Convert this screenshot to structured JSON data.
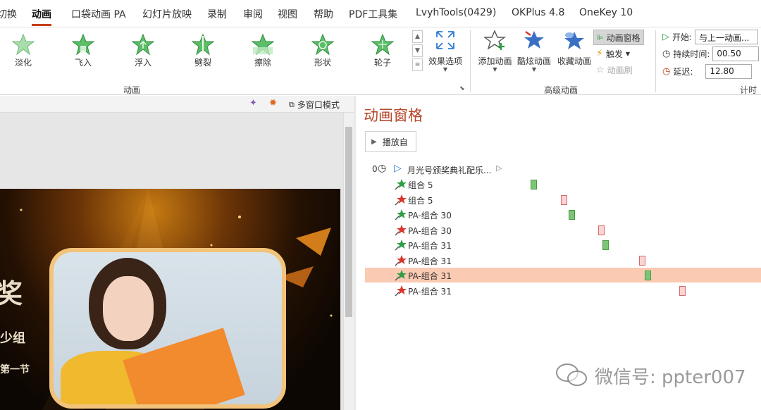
{
  "menu": {
    "tabs": [
      "切换",
      "动画",
      "口袋动画 PA",
      "幻灯片放映",
      "录制",
      "审阅",
      "视图",
      "帮助",
      "PDF工具集",
      "LvyhTools(0429)",
      "OKPlus 4.8",
      "OneKey 10"
    ],
    "active": "动画"
  },
  "ribbon": {
    "animations": [
      "淡化",
      "飞入",
      "浮入",
      "劈裂",
      "擦除",
      "形状",
      "轮子"
    ],
    "effect_options": "效果选项",
    "group_animation": "动画",
    "add_animation": "添加动画",
    "cool_animation": "酷炫动画",
    "collect_animation": "收藏动画",
    "animation_pane": "动画窗格",
    "trigger": "触发",
    "animation_painter": "动画刷",
    "group_advanced": "高级动画",
    "timing": {
      "start_label": "开始:",
      "start_value": "与上一动画...",
      "duration_label": "持续时间:",
      "duration_value": "00.50",
      "delay_label": "延迟:",
      "delay_value": "12.80",
      "group_label": "计时"
    }
  },
  "toolbar_strip": {
    "multiwindow": "多窗口模式"
  },
  "pane": {
    "title": "动画窗格",
    "play_button": "播放自",
    "header_row": {
      "index": "0",
      "label": "月光号颁奖典礼配乐..."
    },
    "items": [
      {
        "label": "组合 5",
        "kind": "entry"
      },
      {
        "label": "组合 5",
        "kind": "exit"
      },
      {
        "label": "PA-组合 30",
        "kind": "entry"
      },
      {
        "label": "PA-组合 30",
        "kind": "exit"
      },
      {
        "label": "PA-组合 31",
        "kind": "entry"
      },
      {
        "label": "PA-组合 31",
        "kind": "exit"
      },
      {
        "label": "PA-组合 31",
        "kind": "entry",
        "selected": true
      },
      {
        "label": "PA-组合 31",
        "kind": "exit"
      }
    ]
  },
  "slide": {
    "text_lines": [
      "奖",
      "少组",
      "第一节"
    ]
  },
  "watermark": "微信号: ppter007",
  "colors": {
    "accent": "#c43e1c",
    "pane_title": "#b7472a",
    "entry_green": "#7cc576",
    "exit_red": "#fbd3d3",
    "selected_row": "#fbcab2"
  }
}
